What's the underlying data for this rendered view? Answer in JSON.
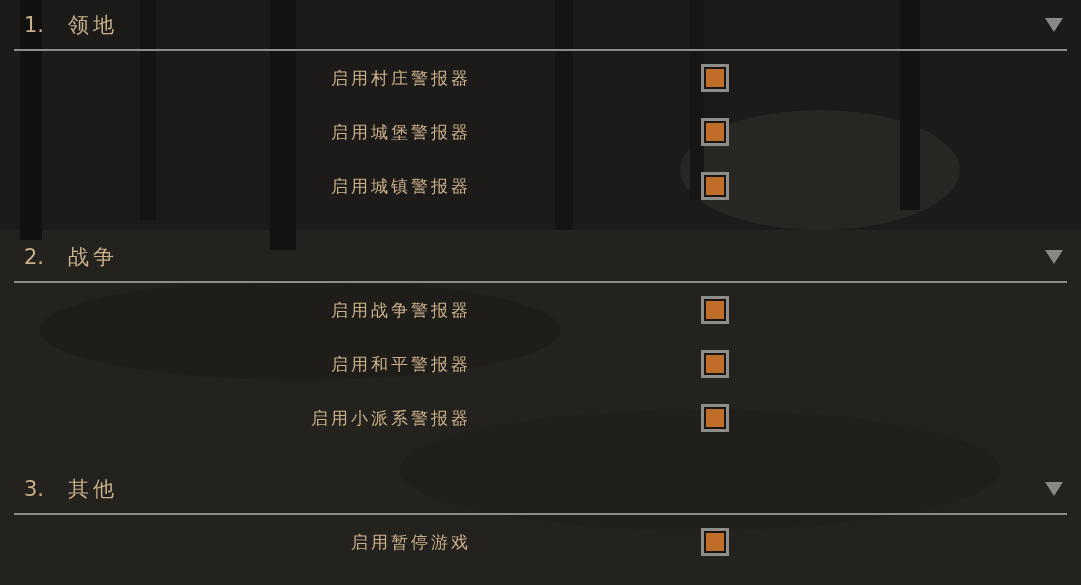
{
  "sections": [
    {
      "number": "1.",
      "title": "领地",
      "expanded": true,
      "options": [
        {
          "label": "启用村庄警报器",
          "checked": true
        },
        {
          "label": "启用城堡警报器",
          "checked": true
        },
        {
          "label": "启用城镇警报器",
          "checked": true
        }
      ]
    },
    {
      "number": "2.",
      "title": "战争",
      "expanded": true,
      "options": [
        {
          "label": "启用战争警报器",
          "checked": true
        },
        {
          "label": "启用和平警报器",
          "checked": true
        },
        {
          "label": "启用小派系警报器",
          "checked": true
        }
      ]
    },
    {
      "number": "3.",
      "title": "其他",
      "expanded": true,
      "options": [
        {
          "label": "启用暂停游戏",
          "checked": true
        }
      ]
    }
  ]
}
